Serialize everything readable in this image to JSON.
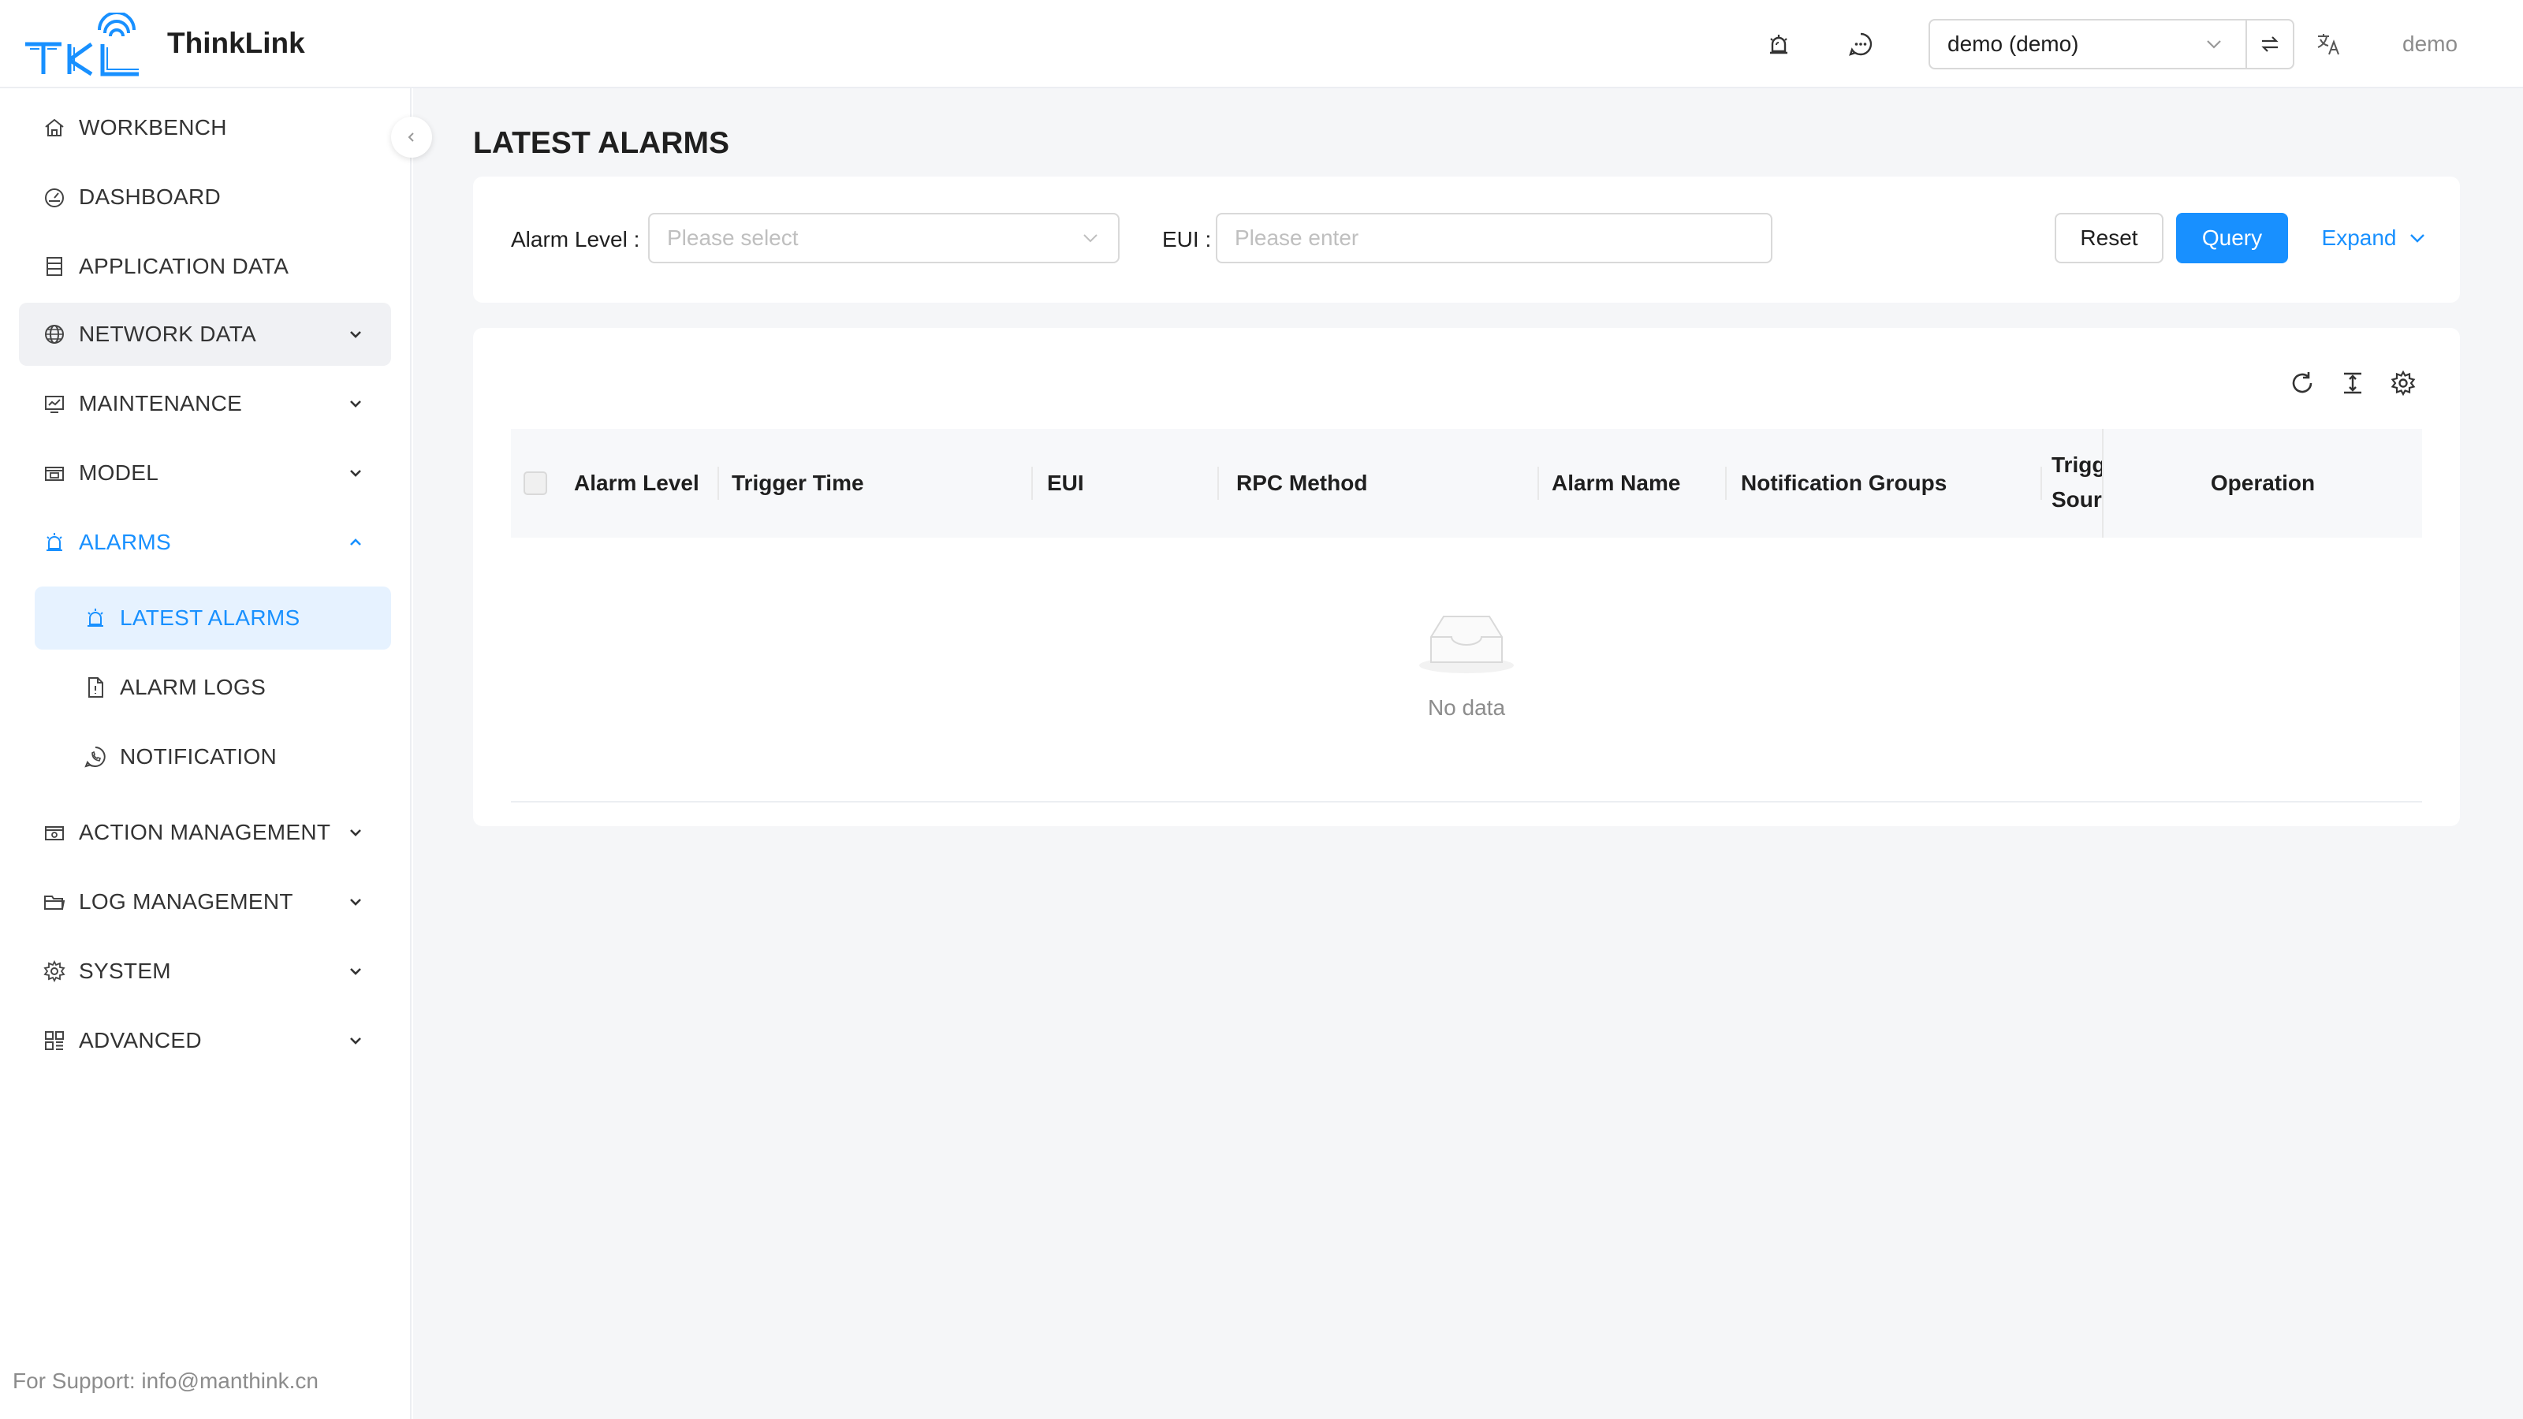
{
  "app": {
    "name": "ThinkLink",
    "logo_text": "TKL",
    "brand_color": "#1890ff"
  },
  "header": {
    "tenant_value": "demo (demo)",
    "user": "demo",
    "icons": [
      "alarm-bell-icon",
      "message-icon",
      "swap-icon",
      "translate-icon"
    ]
  },
  "sidebar": {
    "items": [
      {
        "label": "WORKBENCH",
        "icon": "home-icon"
      },
      {
        "label": "DASHBOARD",
        "icon": "dashboard-icon"
      },
      {
        "label": "APPLICATION DATA",
        "icon": "database-icon"
      },
      {
        "label": "NETWORK DATA",
        "icon": "globe-icon"
      },
      {
        "label": "MAINTENANCE",
        "icon": "maintenance-icon"
      },
      {
        "label": "MODEL",
        "icon": "model-icon"
      },
      {
        "label": "ALARMS",
        "icon": "alarm-icon"
      },
      {
        "label": "ACTION MANAGEMENT",
        "icon": "action-icon"
      },
      {
        "label": "LOG MANAGEMENT",
        "icon": "folder-icon"
      },
      {
        "label": "SYSTEM",
        "icon": "gear-icon"
      },
      {
        "label": "ADVANCED",
        "icon": "apps-icon"
      }
    ],
    "alarms_sub": [
      {
        "label": "LATEST ALARMS",
        "icon": "alarm-icon"
      },
      {
        "label": "ALARM LOGS",
        "icon": "file-icon"
      },
      {
        "label": "NOTIFICATION",
        "icon": "phone-icon"
      }
    ],
    "support": "For Support: info@manthink.cn"
  },
  "page": {
    "title": "LATEST ALARMS"
  },
  "filter": {
    "alarm_level_label": "Alarm Level :",
    "alarm_level_placeholder": "Please select",
    "eui_label": "EUI :",
    "eui_placeholder": "Please enter",
    "reset": "Reset",
    "query": "Query",
    "expand": "Expand"
  },
  "table": {
    "columns": [
      "Alarm Level",
      "Trigger Time",
      "EUI",
      "RPC Method",
      "Alarm Name",
      "Notification Groups",
      "Trigger Source",
      "Operation"
    ],
    "trigger_source_lines": [
      "Trigg",
      "Sour"
    ],
    "empty_text": "No data",
    "toolbar_icons": [
      "refresh-icon",
      "density-icon",
      "settings-icon"
    ]
  }
}
